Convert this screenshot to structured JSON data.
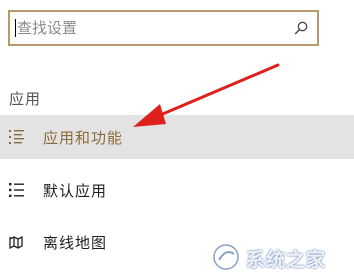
{
  "search": {
    "placeholder": "查找设置",
    "value": "",
    "icon": "search-icon"
  },
  "section": {
    "label": "应用"
  },
  "nav": {
    "items": [
      {
        "label": "应用和功能",
        "icon": "apps-features-icon",
        "selected": true
      },
      {
        "label": "默认应用",
        "icon": "default-apps-icon",
        "selected": false
      },
      {
        "label": "离线地图",
        "icon": "offline-maps-icon",
        "selected": false
      }
    ]
  },
  "colors": {
    "accent": "#b89a6e",
    "selected_text": "#8a6b3a",
    "selected_bg": "#e3e3e3",
    "arrow": "#e0201c"
  },
  "watermark": {
    "text": "系统之家"
  }
}
